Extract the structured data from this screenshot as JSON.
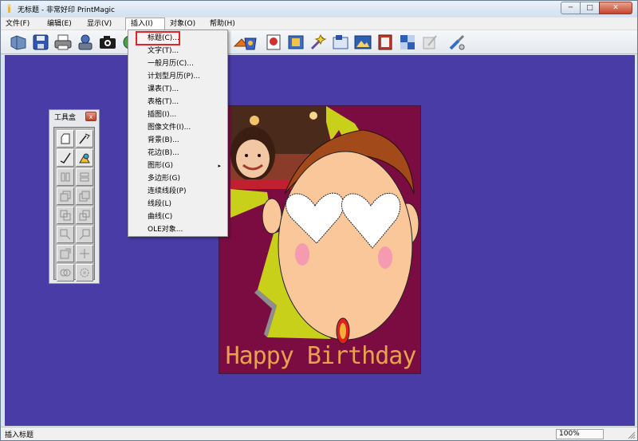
{
  "window": {
    "title": "无标题 - 非常好印 PrintMagic"
  },
  "menubar": {
    "items": [
      {
        "label": "文件(F)",
        "name": "menu-file"
      },
      {
        "label": "编辑(E)",
        "name": "menu-edit"
      },
      {
        "label": "显示(V)",
        "name": "menu-view"
      },
      {
        "label": "插入(I)",
        "name": "menu-insert"
      },
      {
        "label": "对象(O)",
        "name": "menu-object"
      },
      {
        "label": "帮助(H)",
        "name": "menu-help"
      }
    ]
  },
  "insert_menu": {
    "items": [
      "标题(C)...",
      "文字(T)...",
      "一般月历(C)...",
      "计划型月历(P)...",
      "课表(T)...",
      "表格(T)...",
      "插图(I)...",
      "图像文件(I)...",
      "背景(B)...",
      "花边(B)...",
      "图形(G)",
      "多边形(G)",
      "连续线段(P)",
      "线段(L)",
      "曲线(C)",
      "OLE对象..."
    ],
    "submenu_arrow": "▸"
  },
  "toolbox": {
    "title": "工具盒",
    "close_glyph": "x"
  },
  "document": {
    "text": "Happy Birthday"
  },
  "statusbar": {
    "message": "插入标题",
    "zoom": "100%"
  },
  "window_buttons": {
    "minimize": "─",
    "maximize": "□",
    "close": "✕"
  },
  "colors": {
    "workspace": "#4a3ca6",
    "document_bg": "#7b0c42",
    "accent_yellow": "#c8d01a",
    "birthday_text": "#e8a24e",
    "highlight_outline": "#e0242a"
  }
}
